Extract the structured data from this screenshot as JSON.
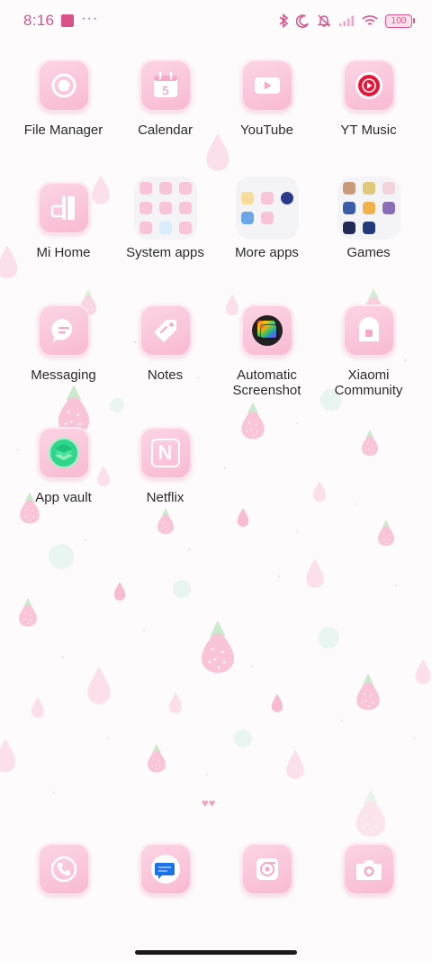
{
  "status_bar": {
    "time": "8:16",
    "battery": "100",
    "accent_color": "#d9538a",
    "icons": [
      "notification-square-icon",
      "more-dots-icon",
      "bluetooth-icon",
      "moon-icon",
      "silent-bell-icon",
      "signal-icon",
      "wifi-icon",
      "battery-icon"
    ]
  },
  "apps": [
    {
      "label": "File Manager",
      "icon": "file-manager-icon"
    },
    {
      "label": "Calendar",
      "icon": "calendar-icon",
      "day": "5"
    },
    {
      "label": "YouTube",
      "icon": "youtube-icon"
    },
    {
      "label": "YT Music",
      "icon": "yt-music-icon"
    },
    {
      "label": "Mi Home",
      "icon": "mi-home-icon"
    },
    {
      "label": "System apps",
      "icon": "folder-icon"
    },
    {
      "label": "More apps",
      "icon": "folder-icon"
    },
    {
      "label": "Games",
      "icon": "folder-icon"
    },
    {
      "label": "Messaging",
      "icon": "messaging-icon"
    },
    {
      "label": "Notes",
      "icon": "notes-icon"
    },
    {
      "label": "Automatic Screenshot",
      "icon": "automatic-screenshot-icon"
    },
    {
      "label": "Xiaomi Community",
      "icon": "xiaomi-community-icon"
    },
    {
      "label": "App vault",
      "icon": "app-vault-icon"
    },
    {
      "label": "Netflix",
      "icon": "netflix-icon",
      "glyph": "N"
    }
  ],
  "dock": [
    {
      "icon": "phone-icon"
    },
    {
      "icon": "messages-icon"
    },
    {
      "icon": "chrome-icon"
    },
    {
      "icon": "camera-icon"
    }
  ],
  "decor": {
    "hearts": "♥♥"
  }
}
